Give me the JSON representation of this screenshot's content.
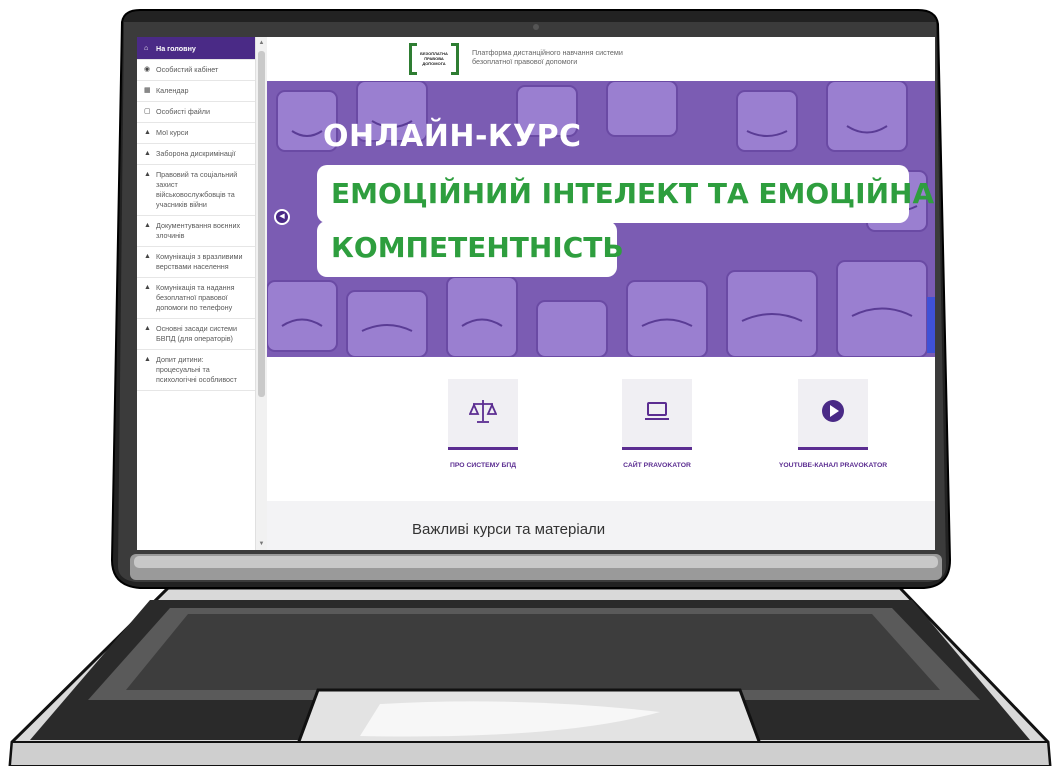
{
  "sidebar": {
    "items": [
      {
        "icon": "home-icon",
        "glyph": "⌂",
        "label": "На головну"
      },
      {
        "icon": "dashboard-icon",
        "glyph": "◉",
        "label": "Особистий кабінет"
      },
      {
        "icon": "calendar-icon",
        "glyph": "▦",
        "label": "Календар"
      },
      {
        "icon": "file-icon",
        "glyph": "▢",
        "label": "Особисті файли"
      },
      {
        "icon": "graduation-cap-icon",
        "glyph": "🎓",
        "label": "Мої курси"
      },
      {
        "icon": "graduation-cap-icon",
        "glyph": "🎓",
        "label": "Заборона дискримінації"
      },
      {
        "icon": "graduation-cap-icon",
        "glyph": "🎓",
        "label": "Правовий та соціальний захист військовослужбовців та учасників війни"
      },
      {
        "icon": "graduation-cap-icon",
        "glyph": "🎓",
        "label": "Документування воєнних злочинів"
      },
      {
        "icon": "graduation-cap-icon",
        "glyph": "🎓",
        "label": "Комунікація з вразливими верствами населення"
      },
      {
        "icon": "graduation-cap-icon",
        "glyph": "🎓",
        "label": "Комунікація та надання безоплатної правової допомоги по телефону"
      },
      {
        "icon": "graduation-cap-icon",
        "glyph": "🎓",
        "label": "Основні засади системи БВПД (для операторів)"
      },
      {
        "icon": "graduation-cap-icon",
        "glyph": "🎓",
        "label": "Допит дитини: процесуальні та психологічні особливост"
      }
    ]
  },
  "header": {
    "logo_text": "БЕЗОПЛАТНА ПРАВОВА ДОПОМОГА",
    "platform_line1": "Платформа дистанційного навчання системи",
    "platform_line2": "безоплатної правової допомоги"
  },
  "hero": {
    "pre_title": "ОНЛАЙН-КУРС",
    "title_line1": "ЕМОЦІЙНИЙ ІНТЕЛЕКТ ТА ЕМОЦІЙНА",
    "title_line2": "КОМПЕТЕНТНІСТЬ",
    "accent_color": "#2e9e3e",
    "bg_color": "#7b5cb3"
  },
  "quick_links": [
    {
      "icon": "scales-icon",
      "label": "ПРО СИСТЕМУ БПД"
    },
    {
      "icon": "laptop-icon",
      "label": "САЙТ PRAVOKATOR"
    },
    {
      "icon": "play-icon",
      "label": "YOUTUBE-КАНАЛ PRAVOKATOR"
    }
  ],
  "important": {
    "title": "Важливі курси та матеріали"
  },
  "colors": {
    "brand_purple": "#4a2a86",
    "link_purple": "#5b2d91"
  }
}
